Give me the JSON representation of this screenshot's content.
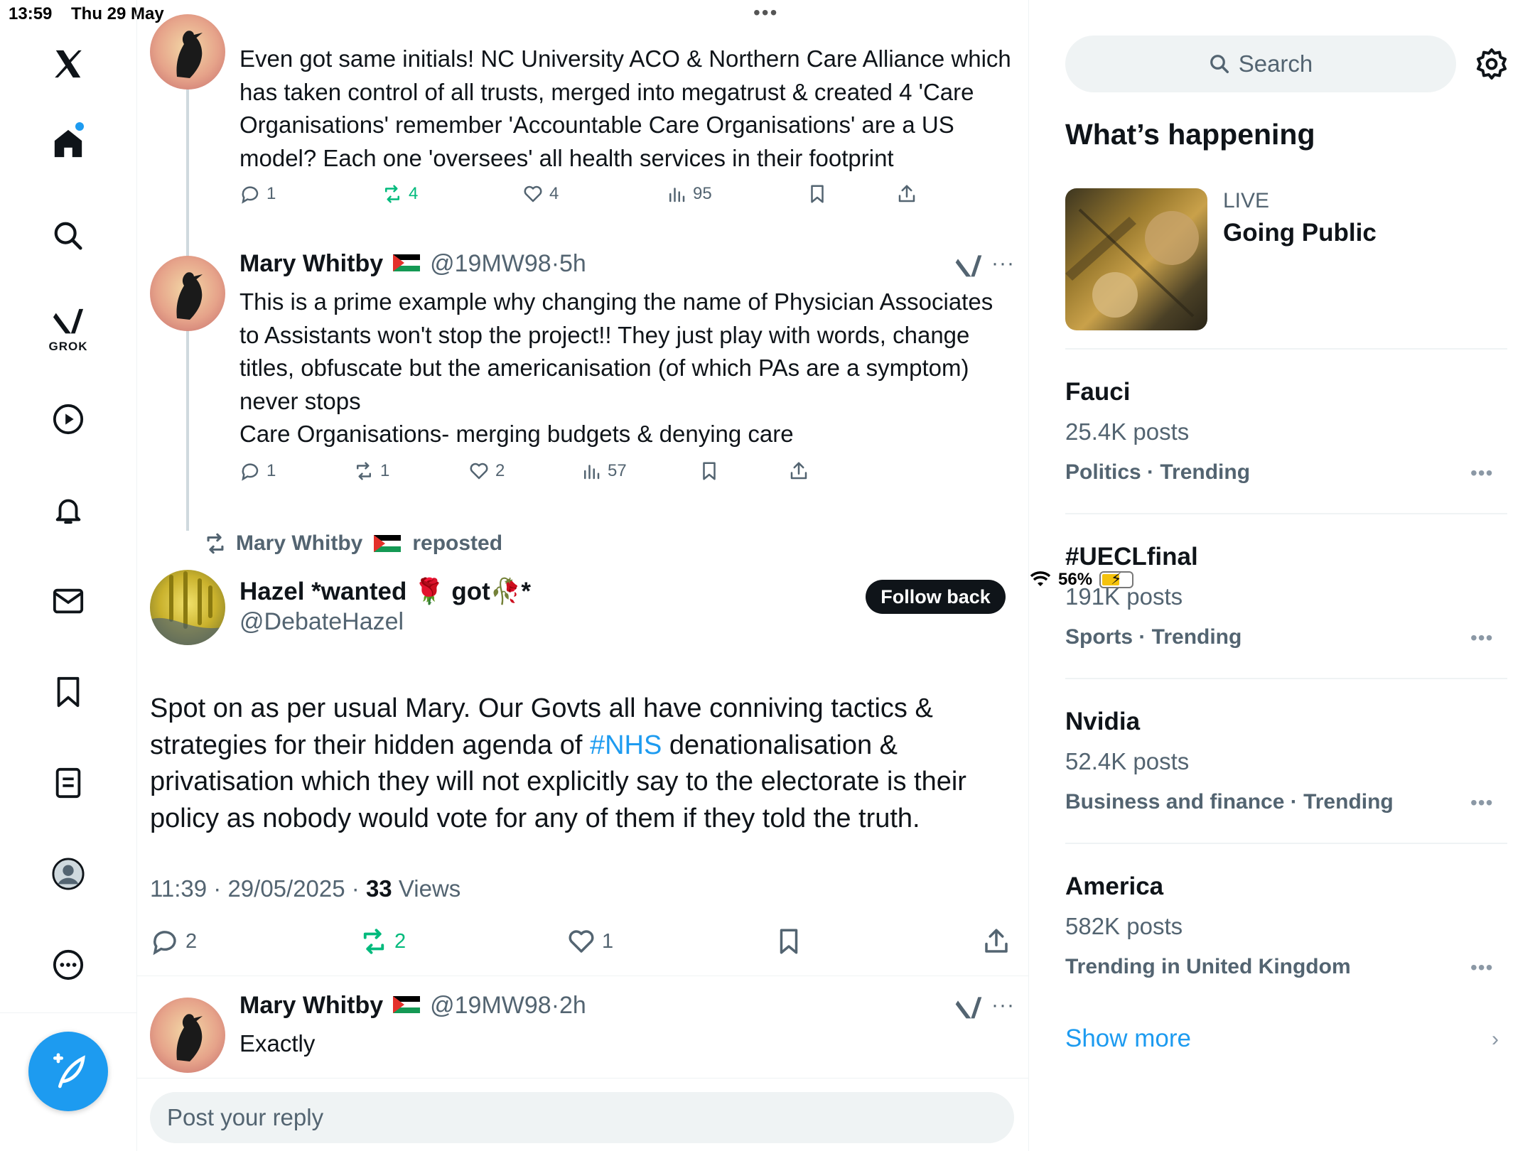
{
  "status_bar": {
    "time": "13:59",
    "date": "Thu 29 May",
    "dots": "•••",
    "battery": "56%"
  },
  "nav": {
    "grok_label": "GROK",
    "accent_color": "#1d9bf0"
  },
  "thread": {
    "tweet1": {
      "text": "Even got same initials! NC University ACO & Northern Care Alliance which has taken control of all trusts, merged into megatrust & created 4 'Care Organisations' remember 'Accountable Care Organisations' are a US model? Each one 'oversees' all health services in their footprint",
      "replies": "1",
      "reposts": "4",
      "likes": "4",
      "views": "95"
    },
    "tweet2": {
      "name": "Mary Whitby",
      "handle": "@19MW98",
      "time": "·5h",
      "text_line1": "This is a prime example why changing the name of Physician Associates to Assistants won't stop the project!! They just play with words, change titles, obfuscate but the americanisation (of which PAs are a symptom) never stops",
      "text_line2": "Care Organisations- merging budgets & denying care",
      "replies": "1",
      "reposts": "1",
      "likes": "2",
      "views": "57"
    },
    "repost_label": {
      "name": "Mary Whitby",
      "suffix": "reposted"
    },
    "focus": {
      "name_part1": "Hazel *wanted ",
      "name_rose": "🌹",
      "name_part2": " got",
      "name_wilt": "🥀",
      "name_part3": "*",
      "handle": "@DebateHazel",
      "follow_label": "Follow back",
      "text_before": "Spot on as per usual Mary.  Our Govts all have conniving tactics & strategies for their hidden agenda of ",
      "hashtag": "#NHS",
      "text_after": " denationalisation & privatisation which they will not explicitly say to the electorate is their policy as nobody would vote for any of them if they told the truth.",
      "timestamp": "11:39 · 29/05/2025 · ",
      "views_count": "33",
      "views_label": " Views",
      "replies": "2",
      "reposts": "2",
      "likes": "1"
    },
    "reply": {
      "name": "Mary Whitby",
      "handle": "@19MW98",
      "time": "·2h",
      "text": "Exactly"
    },
    "reply_placeholder": "Post your reply"
  },
  "sidebar": {
    "search_placeholder": "Search",
    "section_title": "What’s happening",
    "live": {
      "tag": "LIVE",
      "title": "Going Public"
    },
    "trends": [
      {
        "title": "Fauci",
        "count": "25.4K posts",
        "category": "Politics · Trending"
      },
      {
        "title": "#UECLfinal",
        "count": "191K posts",
        "category": "Sports · Trending"
      },
      {
        "title": "Nvidia",
        "count": "52.4K posts",
        "category": "Business and finance · Trending"
      },
      {
        "title": "America",
        "count": "582K posts",
        "category": "Trending in United Kingdom"
      }
    ],
    "trend_more": "•••",
    "show_more": "Show more",
    "chevron": "›"
  }
}
